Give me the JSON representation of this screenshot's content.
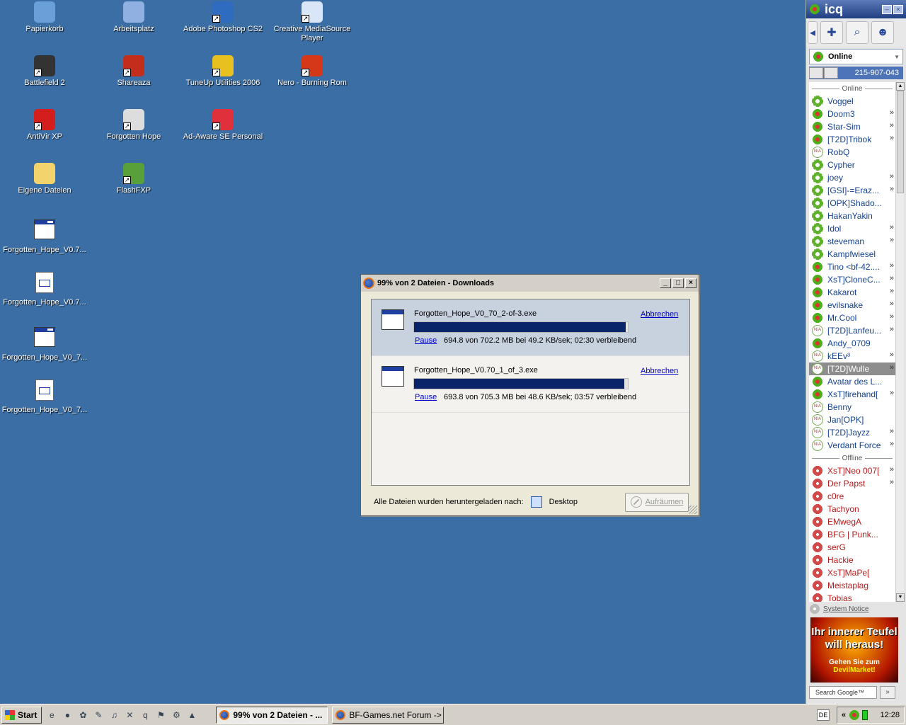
{
  "desktop": {
    "icons": [
      {
        "label": "Papierkorb",
        "icon": "recycle-bin-icon"
      },
      {
        "label": "Arbeitsplatz",
        "icon": "my-computer-icon"
      },
      {
        "label": "Adobe Photoshop CS2",
        "icon": "photoshop-icon"
      },
      {
        "label": "Creative MediaSource Player",
        "icon": "media-player-icon"
      },
      {
        "label": "Battlefield 2",
        "icon": "battlefield-icon"
      },
      {
        "label": "Shareaza",
        "icon": "shareaza-icon"
      },
      {
        "label": "TuneUp Utilities 2006",
        "icon": "tuneup-icon"
      },
      {
        "label": "Nero - Burning Rom",
        "icon": "nero-icon"
      },
      {
        "label": "AntiVir XP",
        "icon": "antivir-icon"
      },
      {
        "label": "Forgotten Hope",
        "icon": "forgotten-hope-icon"
      },
      {
        "label": "Ad-Aware SE Personal",
        "icon": "adaware-icon"
      },
      {
        "label": "Eigene Dateien",
        "icon": "folder-icon"
      },
      {
        "label": "FlashFXP",
        "icon": "flashfxp-icon"
      },
      {
        "label": "Forgotten_Hope_V0.7...",
        "icon": "exe-file-icon"
      },
      {
        "label": "Forgotten_Hope_V0.7...",
        "icon": "document-file-icon"
      },
      {
        "label": "Forgotten_Hope_V0_7...",
        "icon": "exe-file-icon"
      },
      {
        "label": "Forgotten_Hope_V0_7...",
        "icon": "document-file-icon"
      }
    ]
  },
  "downloads": {
    "title": "99% von 2 Dateien - Downloads",
    "items": [
      {
        "filename": "Forgotten_Hope_V0_70_2-of-3.exe",
        "progress": 0.99,
        "pause_label": "Pause",
        "status": "694.8 von 702.2 MB bei 49.2 KB/sek; 02:30 verbleibend",
        "cancel_label": "Abbrechen"
      },
      {
        "filename": "Forgotten_Hope_V0.70_1_of_3.exe",
        "progress": 0.984,
        "pause_label": "Pause",
        "status": "693.8 von 705.3 MB bei 48.6 KB/sek; 03:57 verbleibend",
        "cancel_label": "Abbrechen"
      }
    ],
    "footer_label": "Alle Dateien wurden heruntergeladen nach:",
    "footer_location": "Desktop",
    "cleanup_label": "Aufräumen"
  },
  "icq": {
    "title": "icq",
    "status": "Online",
    "uin": "215-907-043",
    "online_group": "Online",
    "offline_group": "Offline",
    "online_contacts": [
      {
        "name": "Voggel",
        "state": "away",
        "msg": false
      },
      {
        "name": "Doom3",
        "state": "online",
        "msg": true
      },
      {
        "name": "Star-Sim",
        "state": "online",
        "msg": true
      },
      {
        "name": "[T2D]Tribok",
        "state": "online",
        "msg": true
      },
      {
        "name": "RobQ",
        "state": "na",
        "msg": false
      },
      {
        "name": "Cypher",
        "state": "away",
        "msg": false
      },
      {
        "name": "joey",
        "state": "away",
        "msg": true
      },
      {
        "name": "[GSI]-=Eraz...",
        "state": "away",
        "msg": true
      },
      {
        "name": "[OPK]Shado...",
        "state": "away",
        "msg": false
      },
      {
        "name": "HakanYakin",
        "state": "away",
        "msg": false
      },
      {
        "name": "Idol",
        "state": "away",
        "msg": true
      },
      {
        "name": "steveman",
        "state": "away",
        "msg": true
      },
      {
        "name": "Kampfwiesel",
        "state": "away",
        "msg": false
      },
      {
        "name": "Tino <bf-42....",
        "state": "online",
        "msg": true
      },
      {
        "name": "XsT]CloneC...",
        "state": "online",
        "msg": true
      },
      {
        "name": "Kakarot",
        "state": "online",
        "msg": true
      },
      {
        "name": "evilsnake",
        "state": "online",
        "msg": true
      },
      {
        "name": "Mr.Cool",
        "state": "online",
        "msg": true
      },
      {
        "name": "[T2D]Lanfeu...",
        "state": "na",
        "msg": true
      },
      {
        "name": "Andy_0709",
        "state": "online",
        "msg": false
      },
      {
        "name": "kEEv³",
        "state": "na",
        "msg": true
      },
      {
        "name": "[T2D]Wulle",
        "state": "na",
        "msg": true,
        "highlight": true
      },
      {
        "name": "Avatar des L...",
        "state": "online",
        "msg": false
      },
      {
        "name": "XsT]firehand[",
        "state": "online",
        "msg": true
      },
      {
        "name": "Benny",
        "state": "na",
        "msg": false
      },
      {
        "name": "Jan[OPK]",
        "state": "na",
        "msg": false
      },
      {
        "name": "[T2D]Jayzz",
        "state": "na",
        "msg": true
      },
      {
        "name": "Verdant Force",
        "state": "na",
        "msg": true
      }
    ],
    "offline_contacts": [
      {
        "name": "XsT]Neo 007[",
        "msg": true
      },
      {
        "name": "Der Papst",
        "msg": true
      },
      {
        "name": "c0re",
        "msg": false
      },
      {
        "name": "Tachyon",
        "msg": false
      },
      {
        "name": "EMwegA",
        "msg": false
      },
      {
        "name": "BFG | Punk...",
        "msg": false
      },
      {
        "name": "serG",
        "msg": false
      },
      {
        "name": "Hackie",
        "msg": false
      },
      {
        "name": "XsT]MaPe[",
        "msg": false
      },
      {
        "name": "Meistaplag",
        "msg": false
      },
      {
        "name": "Tobias",
        "msg": false
      }
    ],
    "more_marker": "»",
    "system_notice": "System Notice",
    "ad": {
      "line1": "Ihr innerer Teufel will heraus!",
      "line2": "Gehen Sie zum",
      "line3": "DevilMarket!"
    },
    "search_label": "Search Google™",
    "search_go": "»"
  },
  "taskbar": {
    "start_label": "Start",
    "tasks": [
      {
        "label": "99% von 2 Dateien - ...",
        "active": true
      },
      {
        "label": "BF-Games.net Forum -> ...",
        "active": false
      }
    ],
    "language": "DE",
    "tray_expand": "«",
    "clock": "12:28"
  }
}
